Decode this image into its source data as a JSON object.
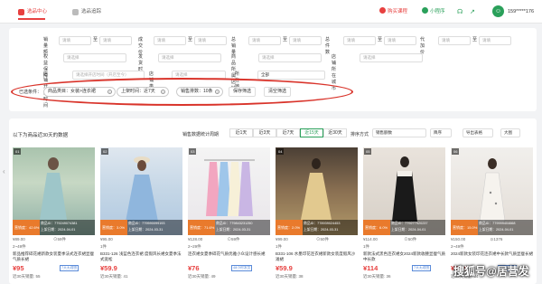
{
  "topbar": {
    "tab_active": "选品中心",
    "tab_other": "选品追踪",
    "download_label": "购买课程",
    "miniprogram_label": "小程序",
    "user_phone": "159*****176"
  },
  "filters": {
    "row1": [
      {
        "label": "销量额",
        "a": "请填",
        "b": "请填"
      },
      {
        "label": "成交价",
        "a": "请填",
        "b": "请填"
      },
      {
        "label": "总销量",
        "a": "请填",
        "b": "请填"
      },
      {
        "label": "总件数",
        "a": "请填",
        "b": "请填"
      },
      {
        "label": "代加价",
        "a": "请填",
        "b": "请填"
      }
    ],
    "row2": [
      {
        "label": "权益保障",
        "value": "请选择"
      },
      {
        "label": "发货时间",
        "value": "请选择"
      },
      {
        "label": "商品所属店铺",
        "value": "请选择"
      },
      {
        "label": "店铺所在城市",
        "value": "请选择"
      }
    ],
    "row3": [
      {
        "label": "店铺开店时间",
        "value": "请选择开店时间（开店至今）"
      },
      {
        "label": "店铺类型",
        "value": "请选择"
      },
      {
        "label": "所在地区",
        "value": "全部"
      }
    ],
    "selected_label": "已选条件：",
    "chips": [
      "商品类目：女装>连衣裙",
      "上架时间：近7天",
      "销售排数：10条"
    ],
    "save_button": "保存筛选",
    "clear_button": "清空筛选"
  },
  "results": {
    "title": "以下为商品近30天的数据",
    "period_label": "销售数据统计周期",
    "segments": [
      "近1天",
      "近3天",
      "近7天",
      "近15天",
      "近30天"
    ],
    "active_segment": "近15天",
    "sort_label": "排序方式",
    "sort_value": "销售额数",
    "sort_order": "降序",
    "export_button": "导出表格",
    "view_button": "大图"
  },
  "products": [
    {
      "num": "01",
      "pct": "营销度：42.6%",
      "id": "商品ID：779249074381",
      "date": "上架日期：2024-04-01",
      "price_small": "¥89.00",
      "sold": "⊙59件",
      "size": "2~49件",
      "title": "新品推荐碎花裙新款女装夏季法式连衣裙显瘦气质长裙",
      "price": "¥95",
      "tag": "7天无理由",
      "foot": "近30天销量: 55"
    },
    {
      "num": "02",
      "pct": "营销度：3.0%",
      "id": "商品ID：779590099193",
      "date": "上架日期：2024-03-31",
      "price_small": "¥95.00",
      "sold": "",
      "size": "1件",
      "title": "B331-126 浅蓝色连衣裙 度假风长裙女夏季法式宽松",
      "price": "¥59.9",
      "tag": "",
      "foot": "近30天销量: 41"
    },
    {
      "num": "03",
      "pct": "营销度：71.6%",
      "id": "商品ID：779843231250",
      "date": "上架日期：2024-03-31",
      "price_small": "¥128.00",
      "sold": "⊙59件",
      "size": "2~29件",
      "title": "连衣裙女夏季碎花气质优雅小众设计感长裙",
      "price": "¥76",
      "tag": "48小时发货",
      "foot": "近30天销量: 49"
    },
    {
      "num": "04",
      "pct": "营销度：2.0%",
      "id": "商品ID：778939024453",
      "date": "上架日期：2024-03-31",
      "price_small": "¥99.00",
      "sold": "⊙50件",
      "size": "1件",
      "title": "B331-106 水墨印花连衣裙新款女装度假风沙滩裙",
      "price": "¥59.9",
      "tag": "",
      "foot": "近30天销量: 38"
    },
    {
      "num": "05",
      "pct": "营销度：6.0%",
      "id": "商品ID：779277920237",
      "date": "上架日期：2024-04-01",
      "price_small": "¥114.00",
      "sold": "⊙50件",
      "size": "1件",
      "title": "新款法式黑色连衣裙女2024新款收腰显瘦气质中长款",
      "price": "¥114",
      "tag": "7天无理由",
      "foot": "近30天销量: 36"
    },
    {
      "num": "06",
      "pct": "营销度：15.0%",
      "id": "商品ID：779999404668",
      "date": "上架日期：2024-04-01",
      "price_small": "¥150.00",
      "sold": "⊙1376",
      "size": "2~49件",
      "title": "2024新款女装印花连衣裙中长款气质显瘦长裙",
      "price": "¥59.9",
      "tag": "7天无理由",
      "foot": "近30天销量: 34"
    }
  ],
  "watermark": "搜狐号@居营发"
}
